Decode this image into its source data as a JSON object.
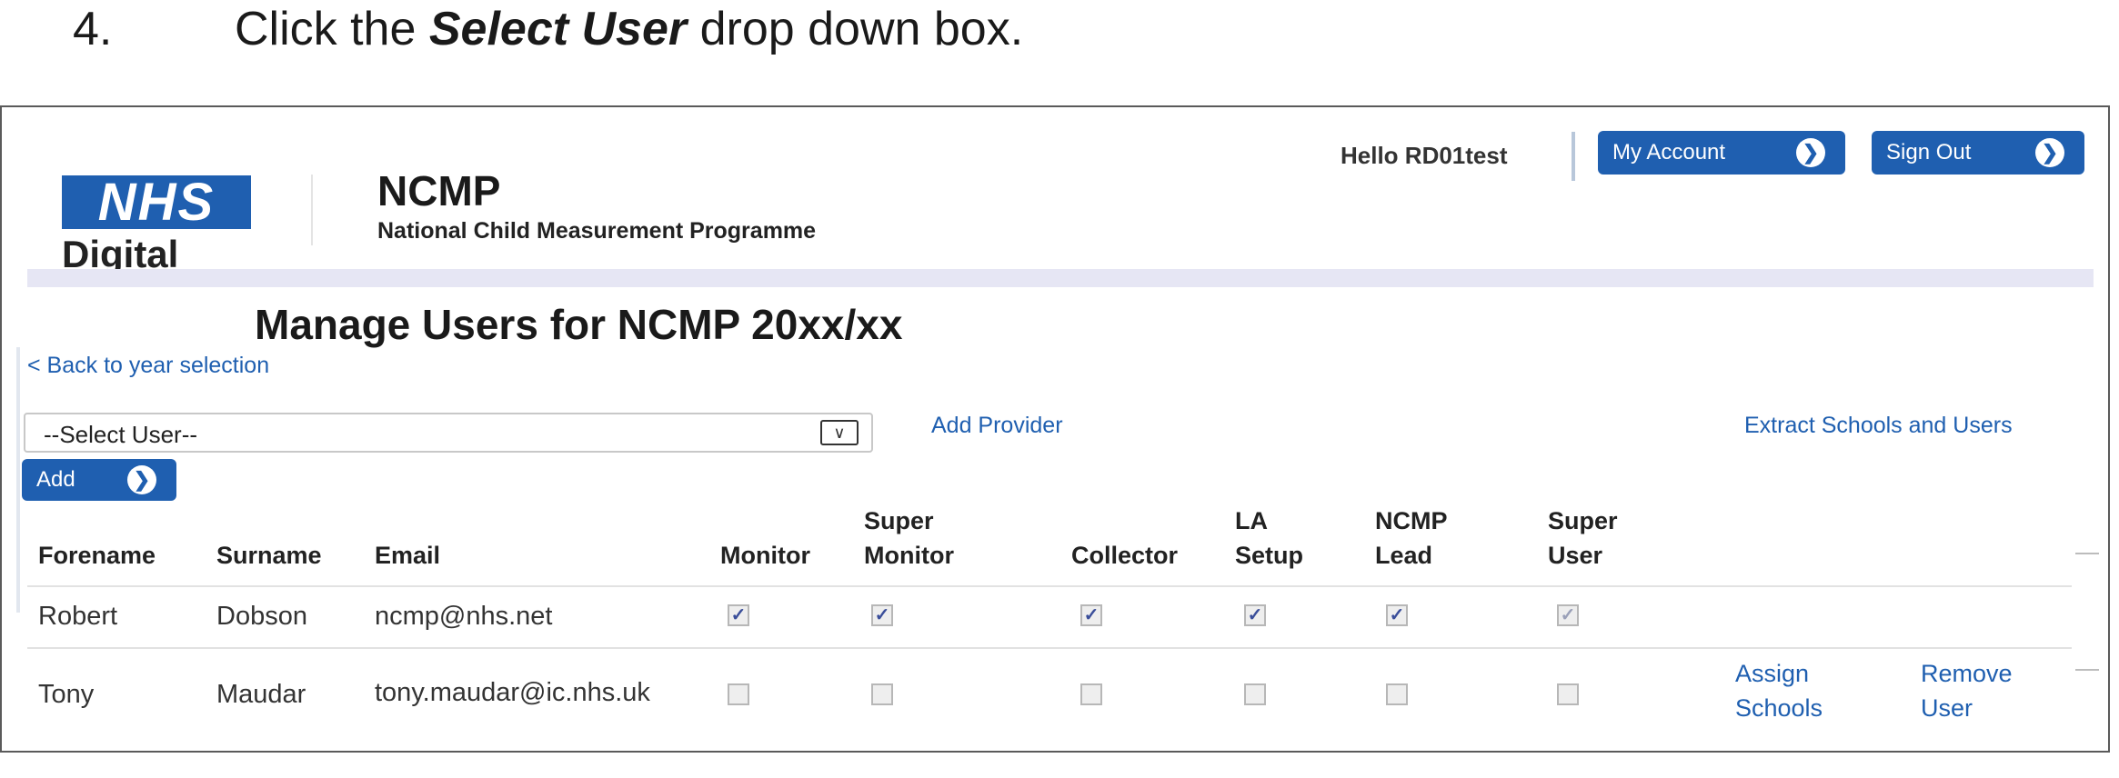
{
  "instruction": {
    "step_number": "4.",
    "text_before": "Click the ",
    "text_emphasis": "Select User",
    "text_after": " drop down box."
  },
  "header": {
    "logo_text": "NHS",
    "logo_subtext": "Digital",
    "app_name": "NCMP",
    "app_full_name": "National Child Measurement Programme",
    "greeting": "Hello RD01test",
    "my_account_label": "My Account",
    "sign_out_label": "Sign Out"
  },
  "page": {
    "title": "Manage Users for NCMP 20xx/xx",
    "back_link": "< Back to year selection",
    "select_user_value": "--Select User--",
    "add_button_label": "Add",
    "add_provider_link": "Add Provider",
    "extract_link": "Extract Schools and Users"
  },
  "table": {
    "headers": {
      "forename": "Forename",
      "surname": "Surname",
      "email": "Email",
      "monitor": "Monitor",
      "super_monitor": [
        "Super",
        "Monitor"
      ],
      "collector": "Collector",
      "la_setup": [
        "LA",
        "Setup"
      ],
      "ncmp_lead": [
        "NCMP",
        "Lead"
      ],
      "super_user": [
        "Super",
        "User"
      ]
    },
    "rows": [
      {
        "forename": "Robert",
        "surname": "Dobson",
        "email": "ncmp@nhs.net",
        "monitor": true,
        "super_monitor": true,
        "collector": true,
        "la_setup": true,
        "ncmp_lead": true,
        "super_user": true
      },
      {
        "forename": "Tony",
        "surname": "Maudar",
        "email": "tony.maudar@ic.nhs.uk",
        "monitor": false,
        "super_monitor": false,
        "collector": false,
        "la_setup": false,
        "ncmp_lead": false,
        "super_user": false,
        "actions": {
          "assign": [
            "Assign",
            "Schools"
          ],
          "remove": [
            "Remove",
            "User"
          ]
        }
      }
    ]
  },
  "colors": {
    "nhs_blue": "#1f5fb0",
    "band": "#e6e6f4",
    "link": "#1f5fb0"
  },
  "icons": {
    "button_arrow": "chevron-right-circle-icon",
    "dropdown": "chevron-down-icon",
    "checkbox_checked": "checkmark-icon"
  }
}
